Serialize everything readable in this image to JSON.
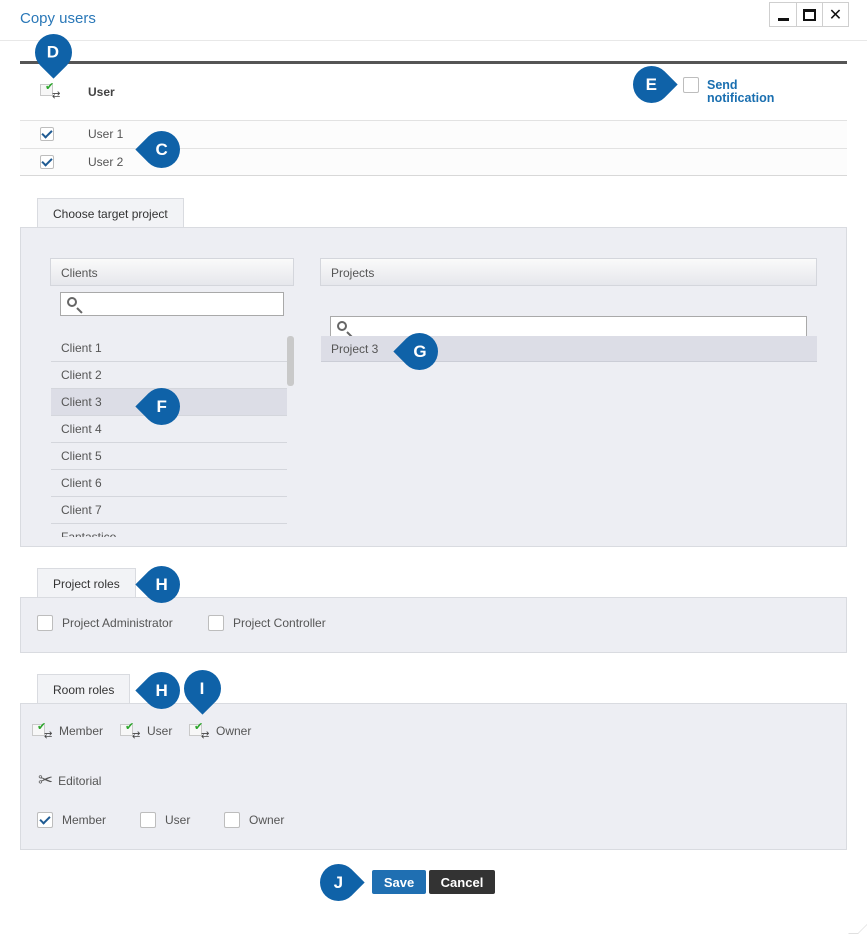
{
  "window": {
    "title": "Copy users",
    "minimize_glyph": "minimize-icon",
    "maximize_glyph": "maximize-icon",
    "close_glyph": "✕"
  },
  "users_table": {
    "header_user": "User",
    "send_notification_line1": "Send",
    "send_notification_line2": "notification",
    "send_notification_checked": false,
    "rows": [
      {
        "label": "User 1",
        "checked": true
      },
      {
        "label": "User 2",
        "checked": true
      }
    ]
  },
  "target_project": {
    "tab_label": "Choose target project",
    "clients_header": "Clients",
    "projects_header": "Projects",
    "clients_search_placeholder": "",
    "projects_search_placeholder": "",
    "clients": [
      "Client 1",
      "Client 2",
      "Client 3",
      "Client 4",
      "Client 5",
      "Client 6",
      "Client 7",
      "Fantastico"
    ],
    "selected_client": "Client 3",
    "projects": [
      "Project 3"
    ],
    "selected_project": "Project 3"
  },
  "project_roles": {
    "tab_label": "Project roles",
    "roles": [
      {
        "label": "Project Administrator",
        "checked": false
      },
      {
        "label": "Project Controller",
        "checked": false
      }
    ]
  },
  "room_roles": {
    "tab_label": "Room roles",
    "toggle_all": [
      {
        "label": "Member"
      },
      {
        "label": "User"
      },
      {
        "label": "Owner"
      }
    ],
    "section_label": "Editorial",
    "editorial_roles": [
      {
        "label": "Member",
        "checked": true
      },
      {
        "label": "User",
        "checked": false
      },
      {
        "label": "Owner",
        "checked": false
      }
    ]
  },
  "buttons": {
    "save": "Save",
    "cancel": "Cancel"
  },
  "markers": {
    "C": "C",
    "D": "D",
    "E": "E",
    "F": "F",
    "G": "G",
    "H1": "H",
    "H2": "H",
    "I": "I",
    "J": "J"
  },
  "colors": {
    "accent": "#1f6fb2",
    "marker": "#0f62a8",
    "panel": "#edeef3",
    "cancel": "#333333"
  }
}
